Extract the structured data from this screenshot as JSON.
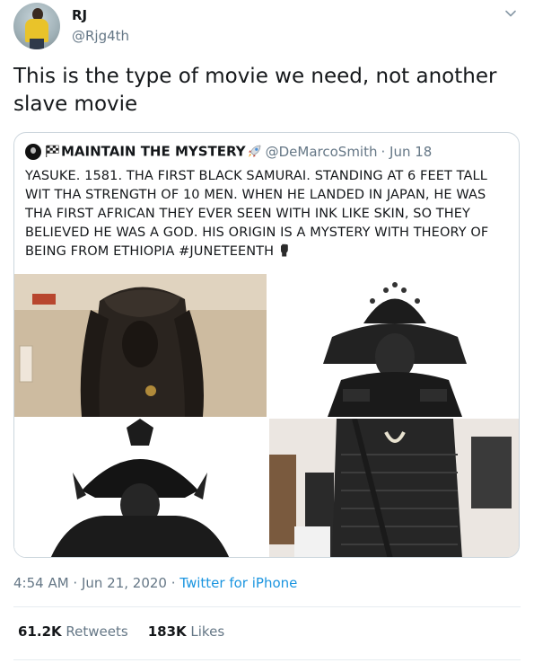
{
  "author": {
    "name": "RJ",
    "handle": "@Rjg4th"
  },
  "tweet_text": "This is the type of movie we need, not another slave movie",
  "quoted": {
    "name": "MAINTAIN THE MYSTERY",
    "handle": "@DeMarcoSmith",
    "date": "· Jun 18",
    "text": "YASUKE. 1581. THA FIRST BLACK SAMURAI. STANDING AT 6 FEET TALL WIT THA STRENGTH OF 10 MEN. WHEN HE LANDED IN JAPAN, HE WAS THA FIRST AFRICAN THEY EVER SEEN WITH INK LIKE SKIN, SO THEY BELIEVED HE WAS A GOD. HIS ORIGIN IS A MYSTERY WITH THEORY OF BEING FROM ETHIOPIA #JUNETEENTH"
  },
  "meta": {
    "time": "4:54 AM",
    "sep1": " · ",
    "date": "Jun 21, 2020",
    "sep2": " · ",
    "source": "Twitter for iPhone"
  },
  "stats": {
    "retweets_count": "61.2K",
    "retweets_label": " Retweets",
    "likes_count": "183K",
    "likes_label": " Likes"
  },
  "icons": {
    "chevron": "chevron-down-icon",
    "flag": "checkered-flag-icon",
    "rocket": "rocket-icon",
    "fist": "raised-fist-icon"
  }
}
